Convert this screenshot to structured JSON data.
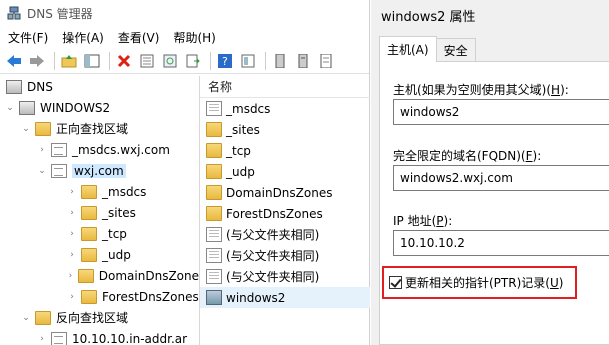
{
  "window": {
    "title": "DNS 管理器"
  },
  "menu": {
    "file": "文件(F)",
    "action": "操作(A)",
    "view": "查看(V)",
    "help": "帮助(H)"
  },
  "tree": {
    "root": "DNS",
    "server": "WINDOWS2",
    "forward": "正向查找区域",
    "zone1": "_msdcs.wxj.com",
    "zone2": "wxj.com",
    "sub1": "_msdcs",
    "sub2": "_sites",
    "sub3": "_tcp",
    "sub4": "_udp",
    "sub5": "DomainDnsZone",
    "sub6": "ForestDnsZones",
    "reverse": "反向查找区域",
    "rzone": "10.10.10.in-addr.ar"
  },
  "list": {
    "header": "名称",
    "items": [
      "_msdcs",
      "_sites",
      "_tcp",
      "_udp",
      "DomainDnsZones",
      "ForestDnsZones",
      "(与父文件夹相同)",
      "(与父文件夹相同)",
      "(与父文件夹相同)",
      "windows2"
    ]
  },
  "dialog": {
    "title": "windows2 属性",
    "tab_host": "主机(A)",
    "tab_security": "安全",
    "host_label_pre": "主机(如果为空则使用其父域)(",
    "host_label_key": "H",
    "host_label_post": "):",
    "host_value": "windows2",
    "fqdn_label_pre": "完全限定的域名(FQDN)(",
    "fqdn_label_key": "F",
    "fqdn_label_post": "):",
    "fqdn_value": "windows2.wxj.com",
    "ip_label_pre": "IP 地址(",
    "ip_label_key": "P",
    "ip_label_post": "):",
    "ip_value": "10.10.10.2",
    "ptr_label_pre": "更新相关的指针(PTR)记录(",
    "ptr_label_key": "U",
    "ptr_label_post": ")",
    "ptr_checked": true
  }
}
